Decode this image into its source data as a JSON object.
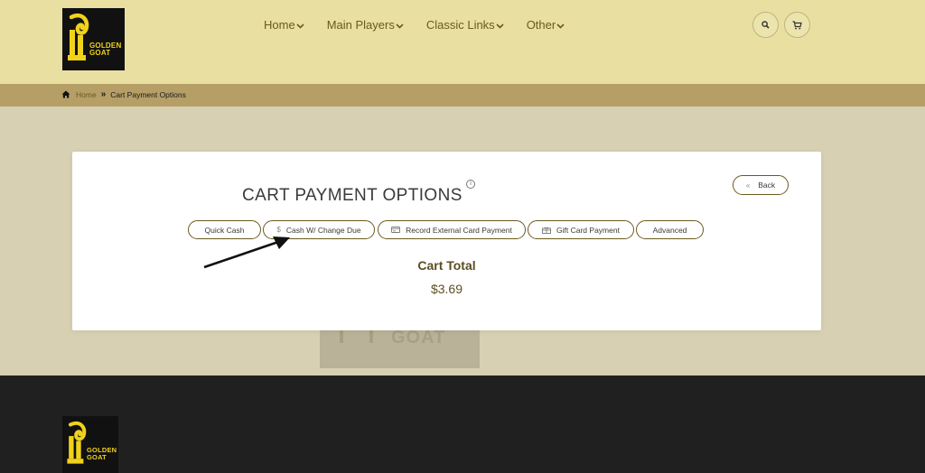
{
  "brand": {
    "logo_text_line1": "GOLDEN",
    "logo_text_line2": "GOAT"
  },
  "nav": {
    "items": [
      {
        "label": "Home"
      },
      {
        "label": "Main Players"
      },
      {
        "label": "Classic Links"
      },
      {
        "label": "Other"
      }
    ]
  },
  "header_actions": {
    "search_icon": "search-icon",
    "cart_icon": "cart-icon"
  },
  "breadcrumb": {
    "home": "Home",
    "separator": "»",
    "current": "Cart Payment Options"
  },
  "card": {
    "title": "CART PAYMENT OPTIONS",
    "info_icon": "i",
    "back_label": "Back",
    "payment_buttons": [
      {
        "label": "Quick Cash",
        "icon": ""
      },
      {
        "label": "Cash W/ Change Due",
        "icon": "dollar-icon"
      },
      {
        "label": "Record External Card Payment",
        "icon": "credit-card-icon"
      },
      {
        "label": "Gift Card Payment",
        "icon": "gift-icon"
      },
      {
        "label": "Advanced",
        "icon": ""
      }
    ],
    "total_label": "Cart Total",
    "total_value": "$3.69"
  },
  "colors": {
    "header_bg": "#e8dfa1",
    "breadcrumb_bg": "#b59f67",
    "page_bg": "#d7d0b2",
    "accent": "#6b5a1e",
    "footer_bg": "#202020",
    "logo_yellow": "#f0d21b"
  }
}
